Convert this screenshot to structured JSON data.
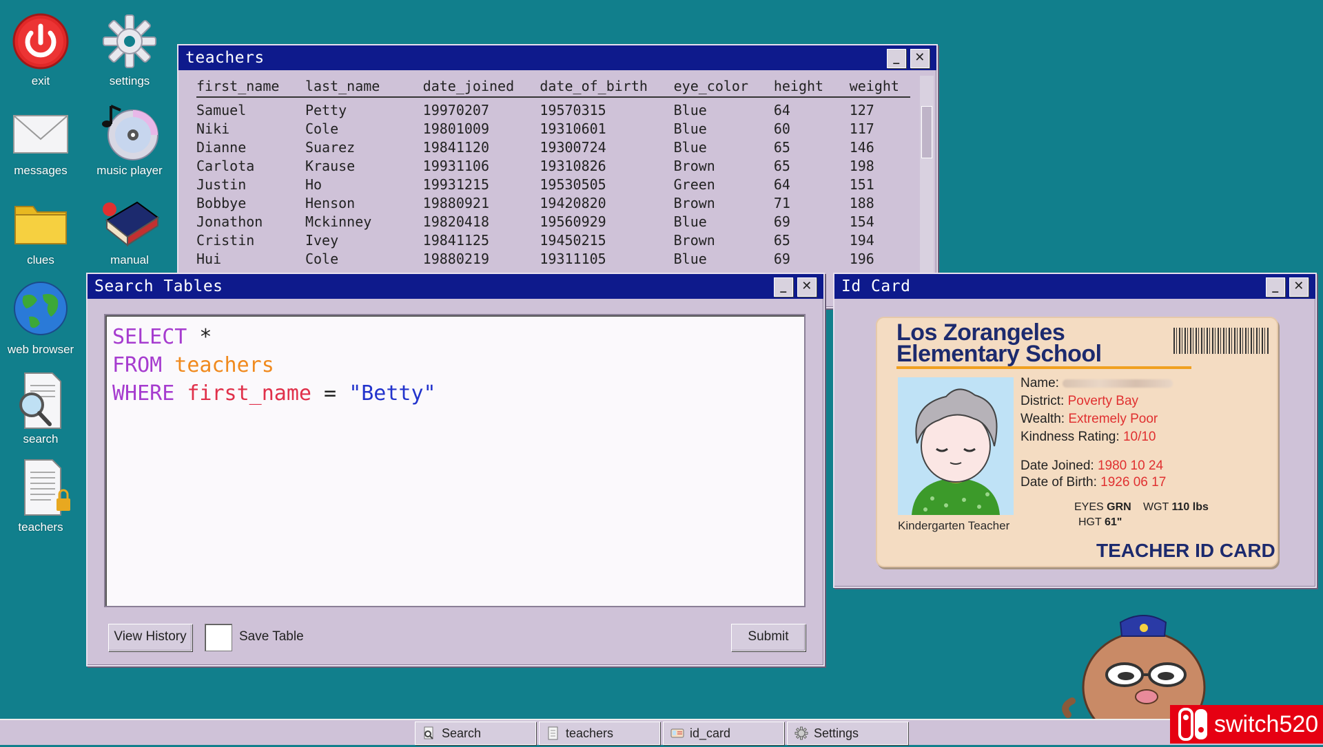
{
  "desktop": {
    "icons": [
      {
        "label": "exit"
      },
      {
        "label": "settings"
      },
      {
        "label": "messages"
      },
      {
        "label": "music player"
      },
      {
        "label": "clues"
      },
      {
        "label": "manual"
      },
      {
        "label": "web browser"
      },
      {
        "label": "search"
      },
      {
        "label": "teachers"
      }
    ]
  },
  "teachers_window": {
    "title": "teachers",
    "columns": [
      "first_name",
      "last_name",
      "date_joined",
      "date_of_birth",
      "eye_color",
      "height",
      "weight"
    ],
    "rows": [
      [
        "Samuel",
        "Petty",
        "19970207",
        "19570315",
        "Blue",
        "64",
        "127"
      ],
      [
        "Niki",
        "Cole",
        "19801009",
        "19310601",
        "Blue",
        "60",
        "117"
      ],
      [
        "Dianne",
        "Suarez",
        "19841120",
        "19300724",
        "Blue",
        "65",
        "146"
      ],
      [
        "Carlota",
        "Krause",
        "19931106",
        "19310826",
        "Brown",
        "65",
        "198"
      ],
      [
        "Justin",
        "Ho",
        "19931215",
        "19530505",
        "Green",
        "64",
        "151"
      ],
      [
        "Bobbye",
        "Henson",
        "19880921",
        "19420820",
        "Brown",
        "71",
        "188"
      ],
      [
        "Jonathon",
        "Mckinney",
        "19820418",
        "19560929",
        "Blue",
        "69",
        "154"
      ],
      [
        "Cristin",
        "Ivey",
        "19841125",
        "19450215",
        "Brown",
        "65",
        "194"
      ],
      [
        "Hui",
        "Cole",
        "19880219",
        "19311105",
        "Blue",
        "69",
        "196"
      ]
    ]
  },
  "search_window": {
    "title": "Search Tables",
    "query": {
      "select_kw": "SELECT",
      "select_star": " *",
      "from_kw": "FROM",
      "table": " teachers",
      "where_kw": "WHERE",
      "column": " first_name",
      "op": " = ",
      "value": "\"Betty\""
    },
    "view_history": "View History",
    "save_table": "Save Table",
    "submit": "Submit"
  },
  "id_window": {
    "title": "Id Card",
    "school_line1": "Los Zorangeles",
    "school_line2": "Elementary School",
    "name_label": "Name:",
    "district_label": "District:",
    "district": "Poverty Bay",
    "wealth_label": "Wealth:",
    "wealth": "Extremely Poor",
    "kindness_label": "Kindness Rating:",
    "kindness": "10/10",
    "joined_label": "Date Joined:",
    "joined": "1980 10 24",
    "dob_label": "Date of Birth:",
    "dob": "1926 06 17",
    "eyes_label": "EYES",
    "eyes": "GRN",
    "wgt_label": "WGT",
    "wgt": "110 lbs",
    "hgt_label": "HGT",
    "hgt": "61\"",
    "role": "Kindergarten Teacher",
    "card_type": "TEACHER ID CARD"
  },
  "taskbar": {
    "items": [
      {
        "label": "Search"
      },
      {
        "label": "teachers"
      },
      {
        "label": "id_card"
      },
      {
        "label": "Settings"
      }
    ]
  },
  "watermark": "switch520"
}
